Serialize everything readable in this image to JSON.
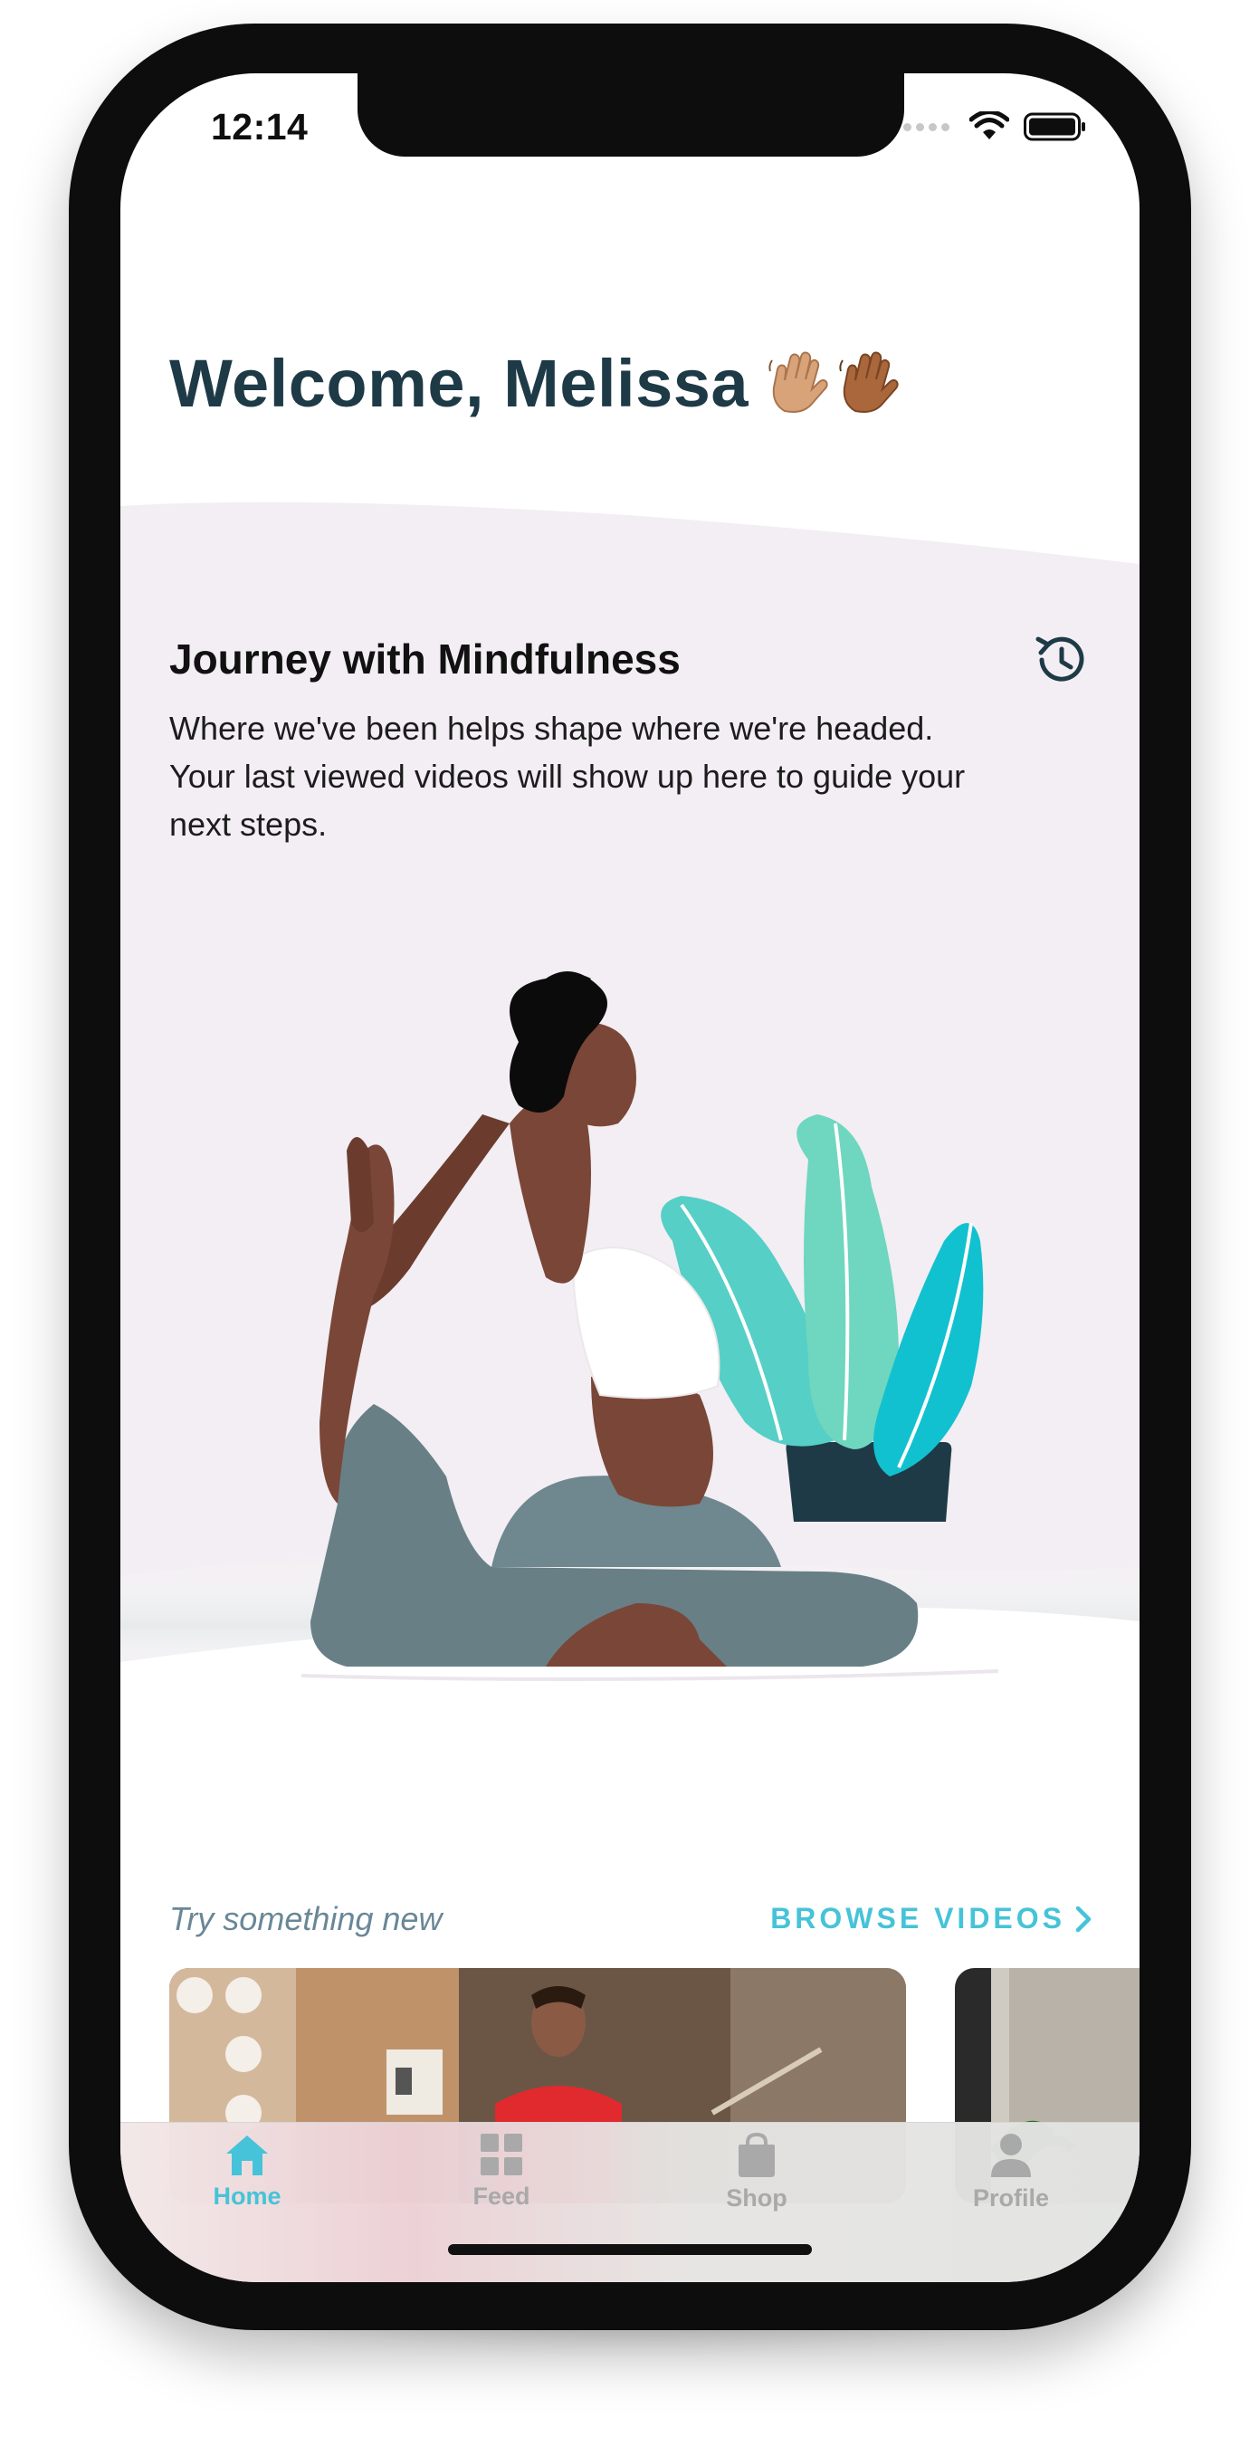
{
  "status_bar": {
    "time": "12:14"
  },
  "header": {
    "welcome": "Welcome, Melissa",
    "emoji": "👋🏽👋🏾"
  },
  "journey": {
    "title": "Journey with Mindfulness",
    "description": "Where we've been helps shape where we're headed. Your last viewed videos will show up here to guide your next steps.",
    "icon": "history-icon"
  },
  "discover": {
    "label": "Try something new",
    "browse": "BROWSE VIDEOS"
  },
  "tabs": [
    {
      "label": "Home",
      "icon": "home-icon",
      "active": true
    },
    {
      "label": "Feed",
      "icon": "grid-icon",
      "active": false
    },
    {
      "label": "Shop",
      "icon": "bag-icon",
      "active": false
    },
    {
      "label": "Profile",
      "icon": "person-icon",
      "active": false
    }
  ],
  "colors": {
    "accent": "#46c3d8",
    "heading": "#1e3a47",
    "band": "#f2eef3",
    "inactive": "#a9a9a9"
  }
}
